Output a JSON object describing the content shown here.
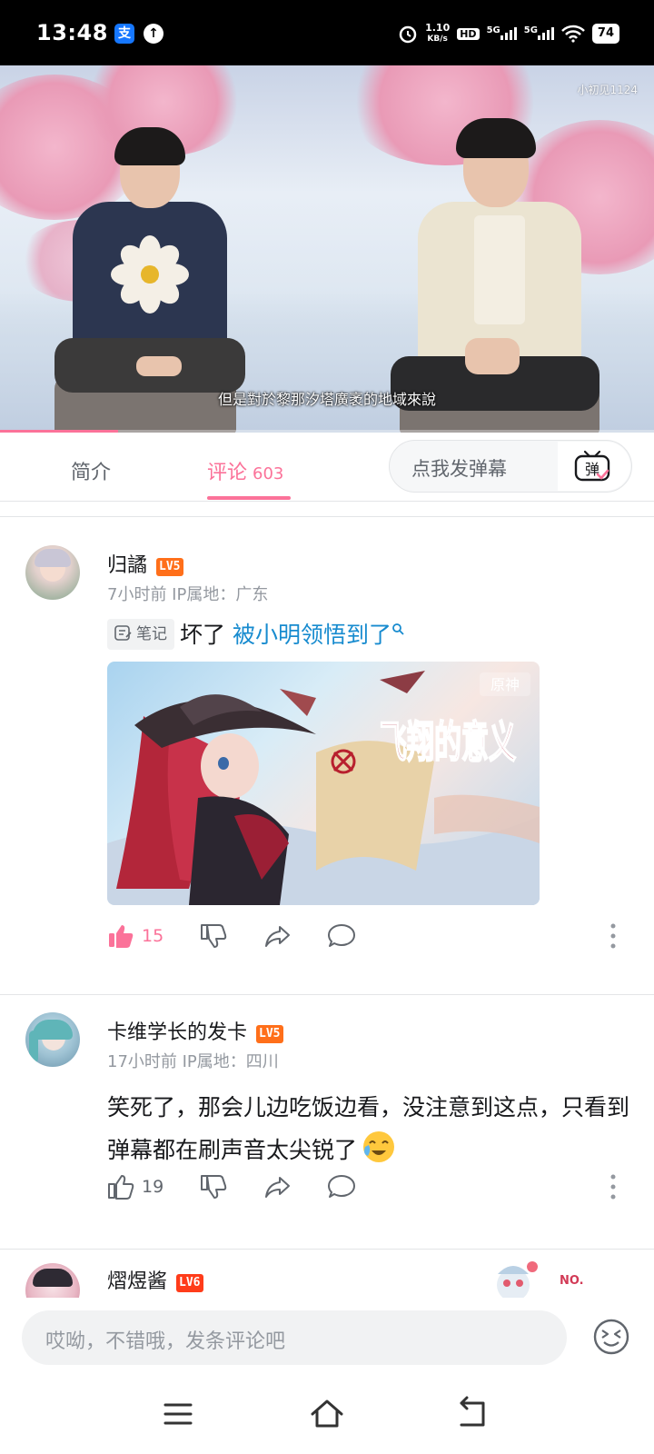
{
  "status_bar": {
    "time": "13:48",
    "alipay_icon": "支",
    "net_speed_top": "1.10",
    "net_speed_unit": "KB/s",
    "hd_label": "HD",
    "signal1_label": "5G",
    "signal2_label": "5G",
    "battery": "74"
  },
  "video": {
    "caption": "但是對於黎那汐塔廣袤的地域來說",
    "watermark": "小初见1124",
    "progress_fraction": 0.18
  },
  "tabs": {
    "intro_label": "简介",
    "comments_label": "评论",
    "comments_count": "603",
    "danmaku_placeholder": "点我发弹幕",
    "danmaku_icon_char": "弹"
  },
  "comments": [
    {
      "username": "归譎",
      "level": "LV5",
      "meta": "7小时前 IP属地：广东",
      "tag": "笔记",
      "text": "坏了 ",
      "link_text": "被小明领悟到了",
      "image_title": "飞翔的意义",
      "image_logo": "原神",
      "likes": "15",
      "liked": true
    },
    {
      "username": "卡维学长的发卡",
      "level": "LV5",
      "meta": "17小时前 IP属地：四川",
      "text": "笑死了，那会儿边吃饭边看，没注意到这点，只看到弹幕都在刷声音太尖锐了",
      "likes": "19",
      "liked": false
    },
    {
      "username": "熠煜酱",
      "level": "LV6",
      "badge_text": "NO."
    }
  ],
  "input": {
    "placeholder": "哎呦，不错哦，发条评论吧"
  },
  "colors": {
    "accent": "#fb7299",
    "link": "#178bcf",
    "level_orange": "#ff6f1a"
  }
}
